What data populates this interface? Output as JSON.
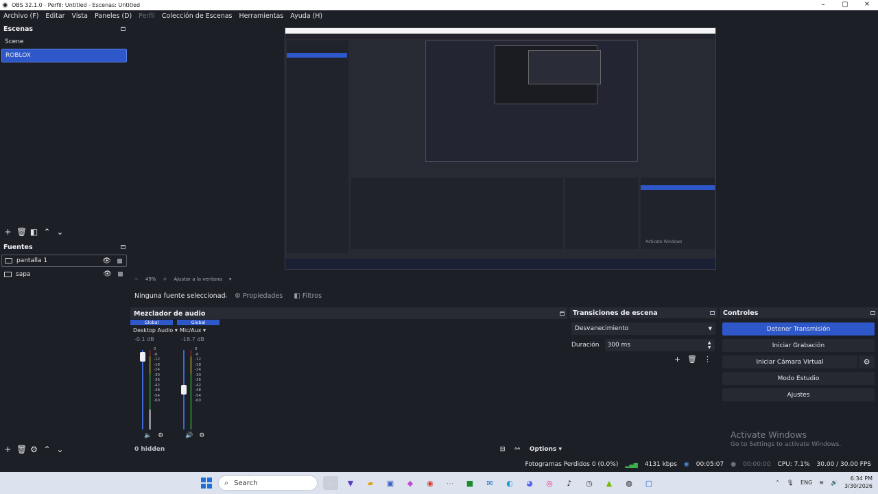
{
  "window": {
    "title": "OBS 32.1.0 - Perfil: Untitled - Escenas: Untitled"
  },
  "menu": [
    "Archivo (F)",
    "Editar",
    "Vista",
    "Paneles (D)",
    "Perfil",
    "Colección de Escenas",
    "Herramientas",
    "Ayuda (H)"
  ],
  "scenes": {
    "title": "Escenas",
    "items": [
      "Scene",
      "ROBLOX"
    ],
    "selected": "ROBLOX"
  },
  "sources": {
    "title": "Fuentes",
    "items": [
      "pantalla 1",
      "sapa"
    ]
  },
  "preview": {
    "zoom": "49%",
    "fit_label": "Ajustar a la ventana",
    "nested_activate": "Activate Windows"
  },
  "context": {
    "no_source": "Ninguna fuente seleccionada",
    "properties": "Propiedades",
    "filters": "Filtros"
  },
  "mixer": {
    "title": "Mezclador de audio",
    "channels": [
      {
        "global": "Global",
        "name": "Desktop Audio",
        "db": "-0.1 dB",
        "level": 0.97
      },
      {
        "global": "Global",
        "name": "Mic/Aux",
        "db": "-18.7 dB",
        "level": 0.5
      }
    ],
    "scale": [
      "0",
      "-6",
      "-12",
      "-18",
      "-24",
      "-30",
      "-36",
      "-42",
      "-48",
      "-54",
      "-60"
    ],
    "hidden": "0 hidden",
    "options": "Options"
  },
  "transitions": {
    "title": "Transiciones de escena",
    "selected": "Desvanecimiento",
    "duration_label": "Duración",
    "duration_value": "300 ms"
  },
  "controls": {
    "title": "Controles",
    "buttons": [
      "Detener Transmisión",
      "Iniciar Grabación",
      "Iniciar Cámara Virtual",
      "Modo Estudio",
      "Ajustes"
    ],
    "activate_title": "Activate Windows",
    "activate_sub": "Go to Settings to activate Windows."
  },
  "status": {
    "dropped": "Fotogramas Perdidos 0 (0.0%)",
    "bitrate": "4131 kbps",
    "stream_time": "00:05:07",
    "rec_time": "00:00:00",
    "cpu": "CPU: 7.1%",
    "fps": "30.00 / 30.00 FPS"
  },
  "taskbar": {
    "search": "Search",
    "lang": "ENG",
    "time": "6:34 PM",
    "date": "3/30/2026"
  },
  "colors": {
    "accent": "#2e57c9",
    "background": "#1d1f26",
    "panel": "#262932"
  }
}
